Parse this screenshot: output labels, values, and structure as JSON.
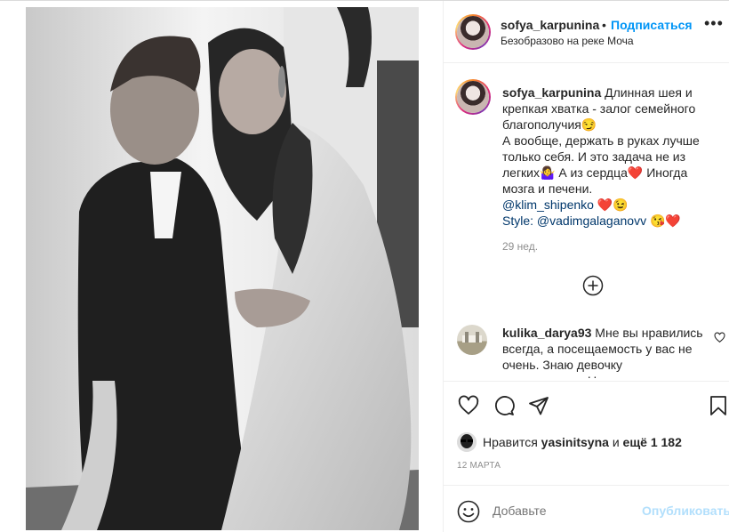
{
  "header": {
    "username": "sofya_karpunina",
    "dot": "•",
    "follow_label": "Подписаться",
    "location": "Безобразово на реке Моча",
    "more_label": "•••"
  },
  "caption": {
    "username": "sofya_karpunina",
    "line1": "Длинная шея и",
    "line2": "крепкая хватка - залог семейного",
    "line3": "благополучия😏",
    "line4": "А вообще, держать в руках лучше",
    "line5": "только себя. И это задача не из",
    "line6": "легких🤷‍♀️ А из сердца❤️ Иногда",
    "line7": "мозга и печени.",
    "mention1": "@klim_shipenko",
    "mention1_emoji": " ❤️😉",
    "style_prefix": "Style: ",
    "mention2": "@vadimgalaganovv",
    "mention2_emoji": " 😘❤️",
    "time": "29 нед."
  },
  "comment": {
    "username": "kulika_darya93",
    "line1": "Мне вы нравились",
    "line2": "всегда, а посещаемость у вас не",
    "line3": "очень. Знаю девочку",
    "line4": "которая сидит Uм"
  },
  "likes": {
    "prefix": "Нравится ",
    "user": "yasinitsyna",
    "middle": " и ",
    "others": "ещё 1 182"
  },
  "date": "12 МАРТА",
  "add_comment": {
    "placeholder": "Добавьте",
    "publish_label": "Опубликовать"
  },
  "icons": {
    "heart": "heart-icon",
    "comment": "comment-icon",
    "share": "paper-plane-icon",
    "save": "bookmark-icon",
    "load_more": "plus-circle-icon",
    "emoji": "smiley-icon"
  },
  "colors": {
    "link_blue": "#0095f6",
    "mention_blue": "#00376b",
    "muted": "#8e8e8e",
    "publish_disabled": "#b2dffc"
  }
}
